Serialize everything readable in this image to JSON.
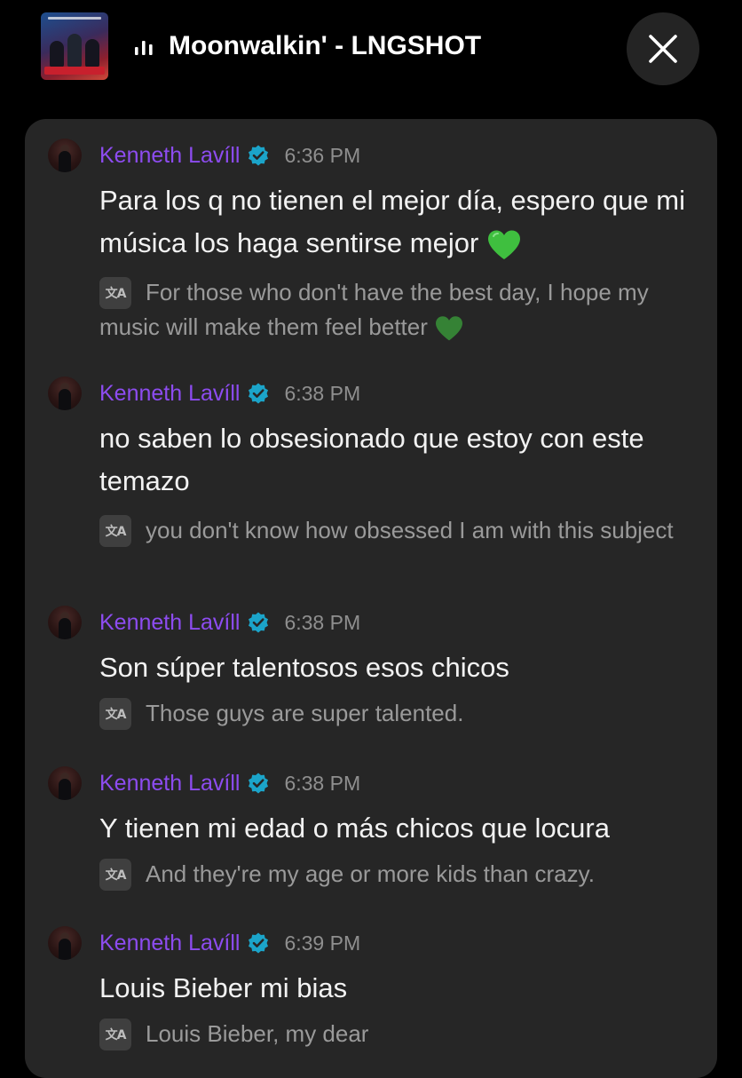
{
  "header": {
    "song_title": "Moonwalkin' - LNGSHOT",
    "album_art_icon": "album-cover",
    "playing_icon": "equalizer-bars-icon",
    "close_icon": "close-icon"
  },
  "colors": {
    "background": "#000000",
    "panel": "#262626",
    "author_name": "#8d4cf0",
    "verified_badge": "#1ba4c9",
    "timestamp": "#8f8f8f",
    "translation_text": "#9a9a9a",
    "heart_emoji": "#3fbf3f"
  },
  "messages": [
    {
      "author": "Kenneth Lavíll",
      "time": "6:36 PM",
      "text": "Para los q no tienen el mejor día, espero que mi música los haga sentirse mejor",
      "translation": "For those who don't have the best day, I hope my music will make them feel better"
    },
    {
      "author": "Kenneth Lavíll",
      "time": "6:38 PM",
      "text": "no saben lo obsesionado que estoy con este temazo",
      "translation": "you don't know how obsessed I am with this subject"
    },
    {
      "author": "Kenneth Lavíll",
      "time": "6:38 PM",
      "text": "Son súper talentosos esos chicos",
      "translation": "Those guys are super talented."
    },
    {
      "author": "Kenneth Lavíll",
      "time": "6:38 PM",
      "text": "Y tienen mi edad o más chicos que locura",
      "translation": "And they're my age or more kids than crazy."
    },
    {
      "author": "Kenneth Lavíll",
      "time": "6:39 PM",
      "text": "Louis Bieber mi bias",
      "translation": "Louis Bieber, my dear"
    }
  ],
  "translate_icon_glyph": "文A"
}
